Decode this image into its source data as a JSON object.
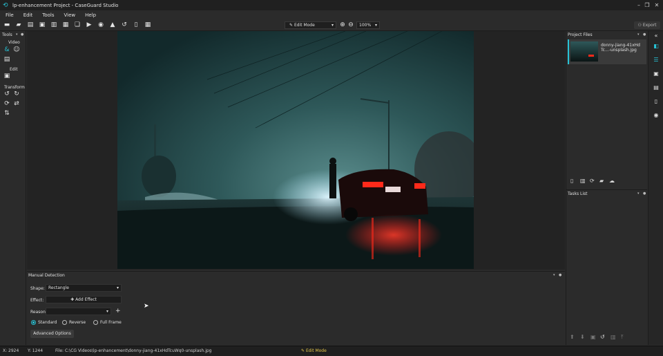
{
  "window": {
    "title": "lp-enhancement Project - CaseGuard Studio",
    "minimize_icon": "minimize-icon",
    "maximize_icon": "restore-icon",
    "close_icon": "close-icon"
  },
  "menu": [
    "File",
    "Edit",
    "Tools",
    "View",
    "Help"
  ],
  "toolbar": {
    "mode": "Edit Mode",
    "zoom": "100%",
    "export_label": "Export"
  },
  "tools_panel": {
    "title": "Tools",
    "sections": {
      "video": "Video",
      "edit": "Edit",
      "transform": "Transform"
    }
  },
  "project_files": {
    "title": "Project Files",
    "items": [
      {
        "name": "donny-jiang-41xHdTc...-unsplash.jpg"
      }
    ]
  },
  "tasks": {
    "title": "Tasks List"
  },
  "manual_detection": {
    "title": "Manual Detection",
    "shape_label": "Shape:",
    "shape_value": "Rectangle",
    "effect_label": "Effect:",
    "add_effect": "Add Effect",
    "reason_label": "Reason:",
    "reason_value": "",
    "options": [
      "Standard",
      "Reverse",
      "Full Frame"
    ],
    "selected_option": "Standard",
    "advanced": "Advanced Options"
  },
  "status": {
    "x": "X: 2924",
    "y": "Y: 1244",
    "file": "File: C:\\CG Videos\\lp-enhancement\\donny-jiang-41xHdTcuWq0-unsplash.jpg",
    "mode": "Edit Mode"
  },
  "colors": {
    "accent": "#27c3d6",
    "mode_yellow": "#e6c84a"
  }
}
